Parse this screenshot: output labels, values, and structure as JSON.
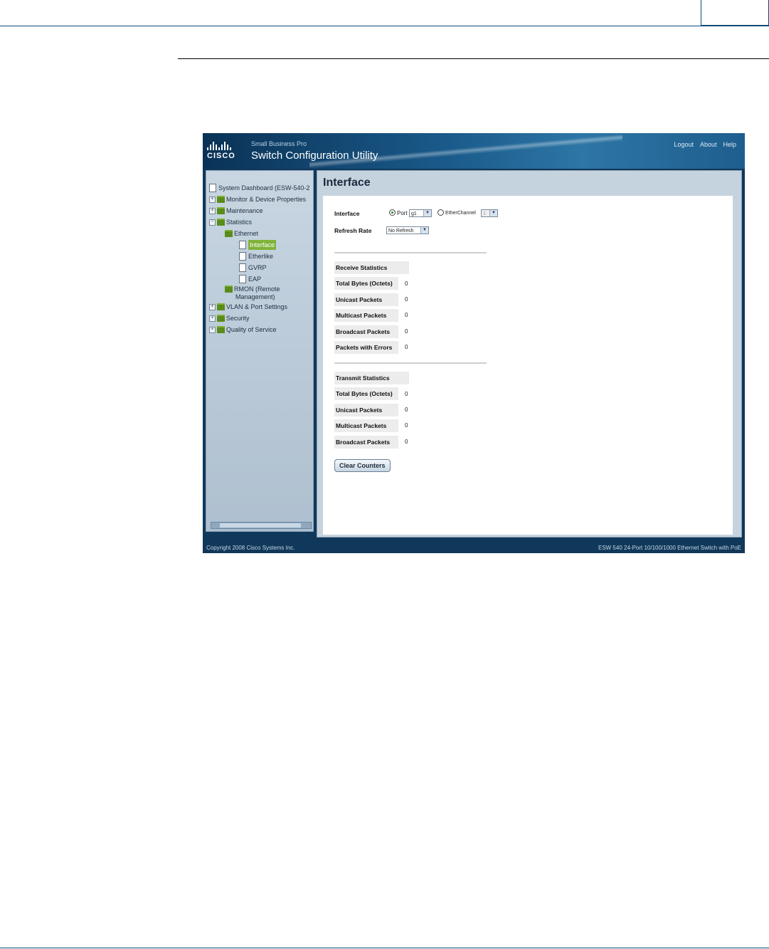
{
  "app": {
    "brand_sub": "Small Business Pro",
    "title": "Switch Configuration Utility",
    "logo_text": "CISCO",
    "header_links": [
      "Logout",
      "About",
      "Help"
    ]
  },
  "tree": {
    "root": "System Dashboard (ESW-540-2",
    "items": [
      {
        "label": "Monitor & Device Properties"
      },
      {
        "label": "Maintenance"
      },
      {
        "label": "Statistics"
      },
      {
        "label": "Ethernet"
      },
      {
        "label": "Interface"
      },
      {
        "label": "Etherlike"
      },
      {
        "label": "GVRP"
      },
      {
        "label": "EAP"
      },
      {
        "label": "RMON (Remote"
      },
      {
        "label": "Management)"
      },
      {
        "label": "VLAN & Port Settings"
      },
      {
        "label": "Security"
      },
      {
        "label": "Quality of Service"
      }
    ]
  },
  "main": {
    "title": "Interface",
    "interface_label": "Interface",
    "port_radio_label": "Port",
    "port_value": "g1",
    "etherchannel_label": "EtherChannel",
    "etherchannel_value": "1",
    "refresh_label": "Refresh Rate",
    "refresh_value": "No Refresh",
    "receive": {
      "header": "Receive Statistics",
      "rows": [
        {
          "label": "Total Bytes (Octets)",
          "value": "0"
        },
        {
          "label": "Unicast Packets",
          "value": "0"
        },
        {
          "label": "Multicast Packets",
          "value": "0"
        },
        {
          "label": "Broadcast Packets",
          "value": "0"
        },
        {
          "label": "Packets with Errors",
          "value": "0"
        }
      ]
    },
    "transmit": {
      "header": "Transmit Statistics",
      "rows": [
        {
          "label": "Total Bytes (Octets)",
          "value": "0"
        },
        {
          "label": "Unicast Packets",
          "value": "0"
        },
        {
          "label": "Multicast Packets",
          "value": "0"
        },
        {
          "label": "Broadcast Packets",
          "value": "0"
        }
      ]
    },
    "clear_button": "Clear Counters"
  },
  "footer": {
    "copyright": "Copyright 2008 Cisco Systems Inc.",
    "product": "ESW 540 24-Port 10/100/1000 Ethernet Switch with PoE"
  }
}
